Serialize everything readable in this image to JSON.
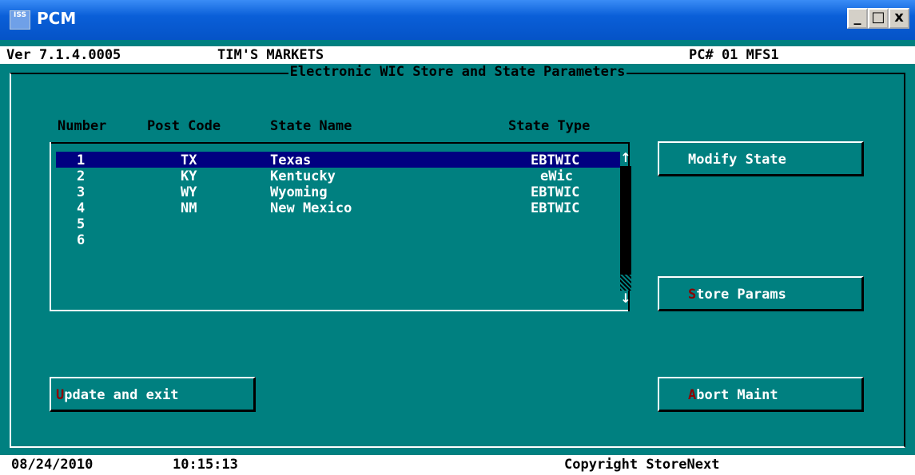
{
  "window": {
    "title": "PCM",
    "icon_text": "ISS",
    "controls": {
      "minimize": "_",
      "maximize": "□",
      "close": "x"
    }
  },
  "header": {
    "version": "Ver 7.1.4.0005",
    "store_name": "TIM'S MARKETS",
    "terminal": "PC# 01 MFS1"
  },
  "panel": {
    "title": "Electronic WIC Store and State Parameters"
  },
  "columns": {
    "number": "Number",
    "post_code": "Post Code",
    "state_name": "State Name",
    "state_type": "State Type"
  },
  "rows": [
    {
      "number": "1",
      "post_code": "TX",
      "state_name": "Texas",
      "state_type": "EBTWIC",
      "selected": true
    },
    {
      "number": "2",
      "post_code": "KY",
      "state_name": "Kentucky",
      "state_type": "eWic",
      "selected": false
    },
    {
      "number": "3",
      "post_code": "WY",
      "state_name": "Wyoming",
      "state_type": "EBTWIC",
      "selected": false
    },
    {
      "number": "4",
      "post_code": "NM",
      "state_name": "New Mexico",
      "state_type": "EBTWIC",
      "selected": false
    },
    {
      "number": "5",
      "post_code": "",
      "state_name": "",
      "state_type": "",
      "selected": false
    },
    {
      "number": "6",
      "post_code": "",
      "state_name": "",
      "state_type": "",
      "selected": false
    }
  ],
  "scrollbar": {
    "up_arrow": "↑",
    "down_arrow": "↓"
  },
  "buttons": {
    "modify_state": {
      "hot": "",
      "rest": "Modify State"
    },
    "store_params": {
      "hot": "S",
      "rest": "tore Params"
    },
    "update_exit": {
      "hot": "U",
      "rest": "pdate and exit"
    },
    "abort_maint": {
      "hot": "A",
      "rest": "bort Maint"
    }
  },
  "status": {
    "date": "08/24/2010",
    "time": "10:15:13",
    "copyright": "Copyright StoreNext"
  },
  "colors": {
    "background": "#008080",
    "selection": "#000080",
    "hotkey": "#8b0000",
    "titlebar": "#0a5fd8"
  }
}
